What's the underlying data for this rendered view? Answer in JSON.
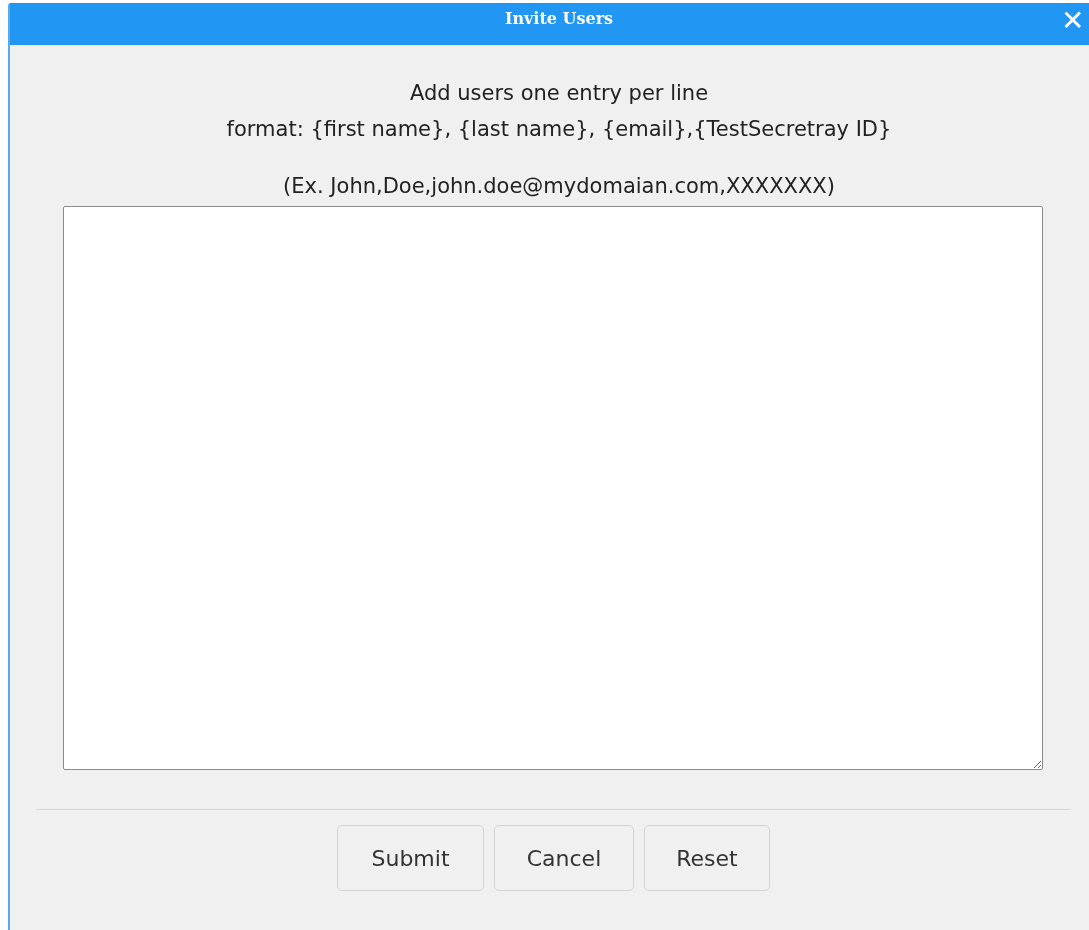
{
  "window": {
    "title": "Invite Users",
    "close": "✕"
  },
  "instructions": [
    "Add users one entry per line",
    "format: {first name}, {last name}, {email},{TestSecretray ID}",
    "(Ex. John,Doe,john.doe@mydomaian.com,XXXXXXX)"
  ],
  "buttons": [
    {
      "label": "Submit"
    },
    {
      "label": "Cancel"
    },
    {
      "label": "Reset"
    }
  ]
}
